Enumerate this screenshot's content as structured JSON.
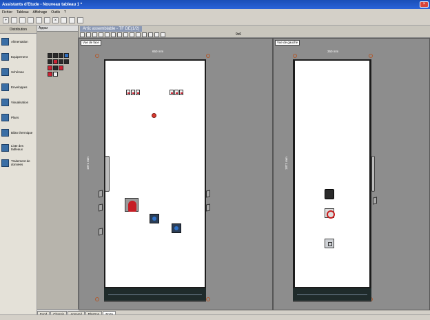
{
  "window": {
    "title": "Assistants d'Etude - Nouveau tableau 1 *"
  },
  "menu": [
    "Fichier",
    "Tableau",
    "Affichage",
    "Outils",
    "?"
  ],
  "sidebar": {
    "header": "Distribution",
    "items": [
      {
        "label": "Alimentation"
      },
      {
        "label": "Equipement"
      },
      {
        "label": "Schémas"
      },
      {
        "label": "Enveloppes"
      },
      {
        "label": "Visualisation"
      },
      {
        "label": "Plans"
      },
      {
        "label": "Bilan thermique"
      },
      {
        "label": "Liste des tableaux"
      },
      {
        "label": "Traitement de données"
      }
    ]
  },
  "library": {
    "tab": "Appar"
  },
  "document": {
    "title": "Artic assemblable - TF DE(1/2)",
    "zoom": "9x6"
  },
  "views": [
    {
      "label": "Vue de face",
      "width_dim": "650 mm",
      "height_dim": "1871 mm"
    },
    {
      "label": "Vue de gauche",
      "width_dim": "350 mm",
      "height_dim": "1871 mm"
    }
  ],
  "bottom_tabs": [
    "Fond",
    "Chassis",
    "Appareil",
    "Plastron",
    "Porte"
  ]
}
